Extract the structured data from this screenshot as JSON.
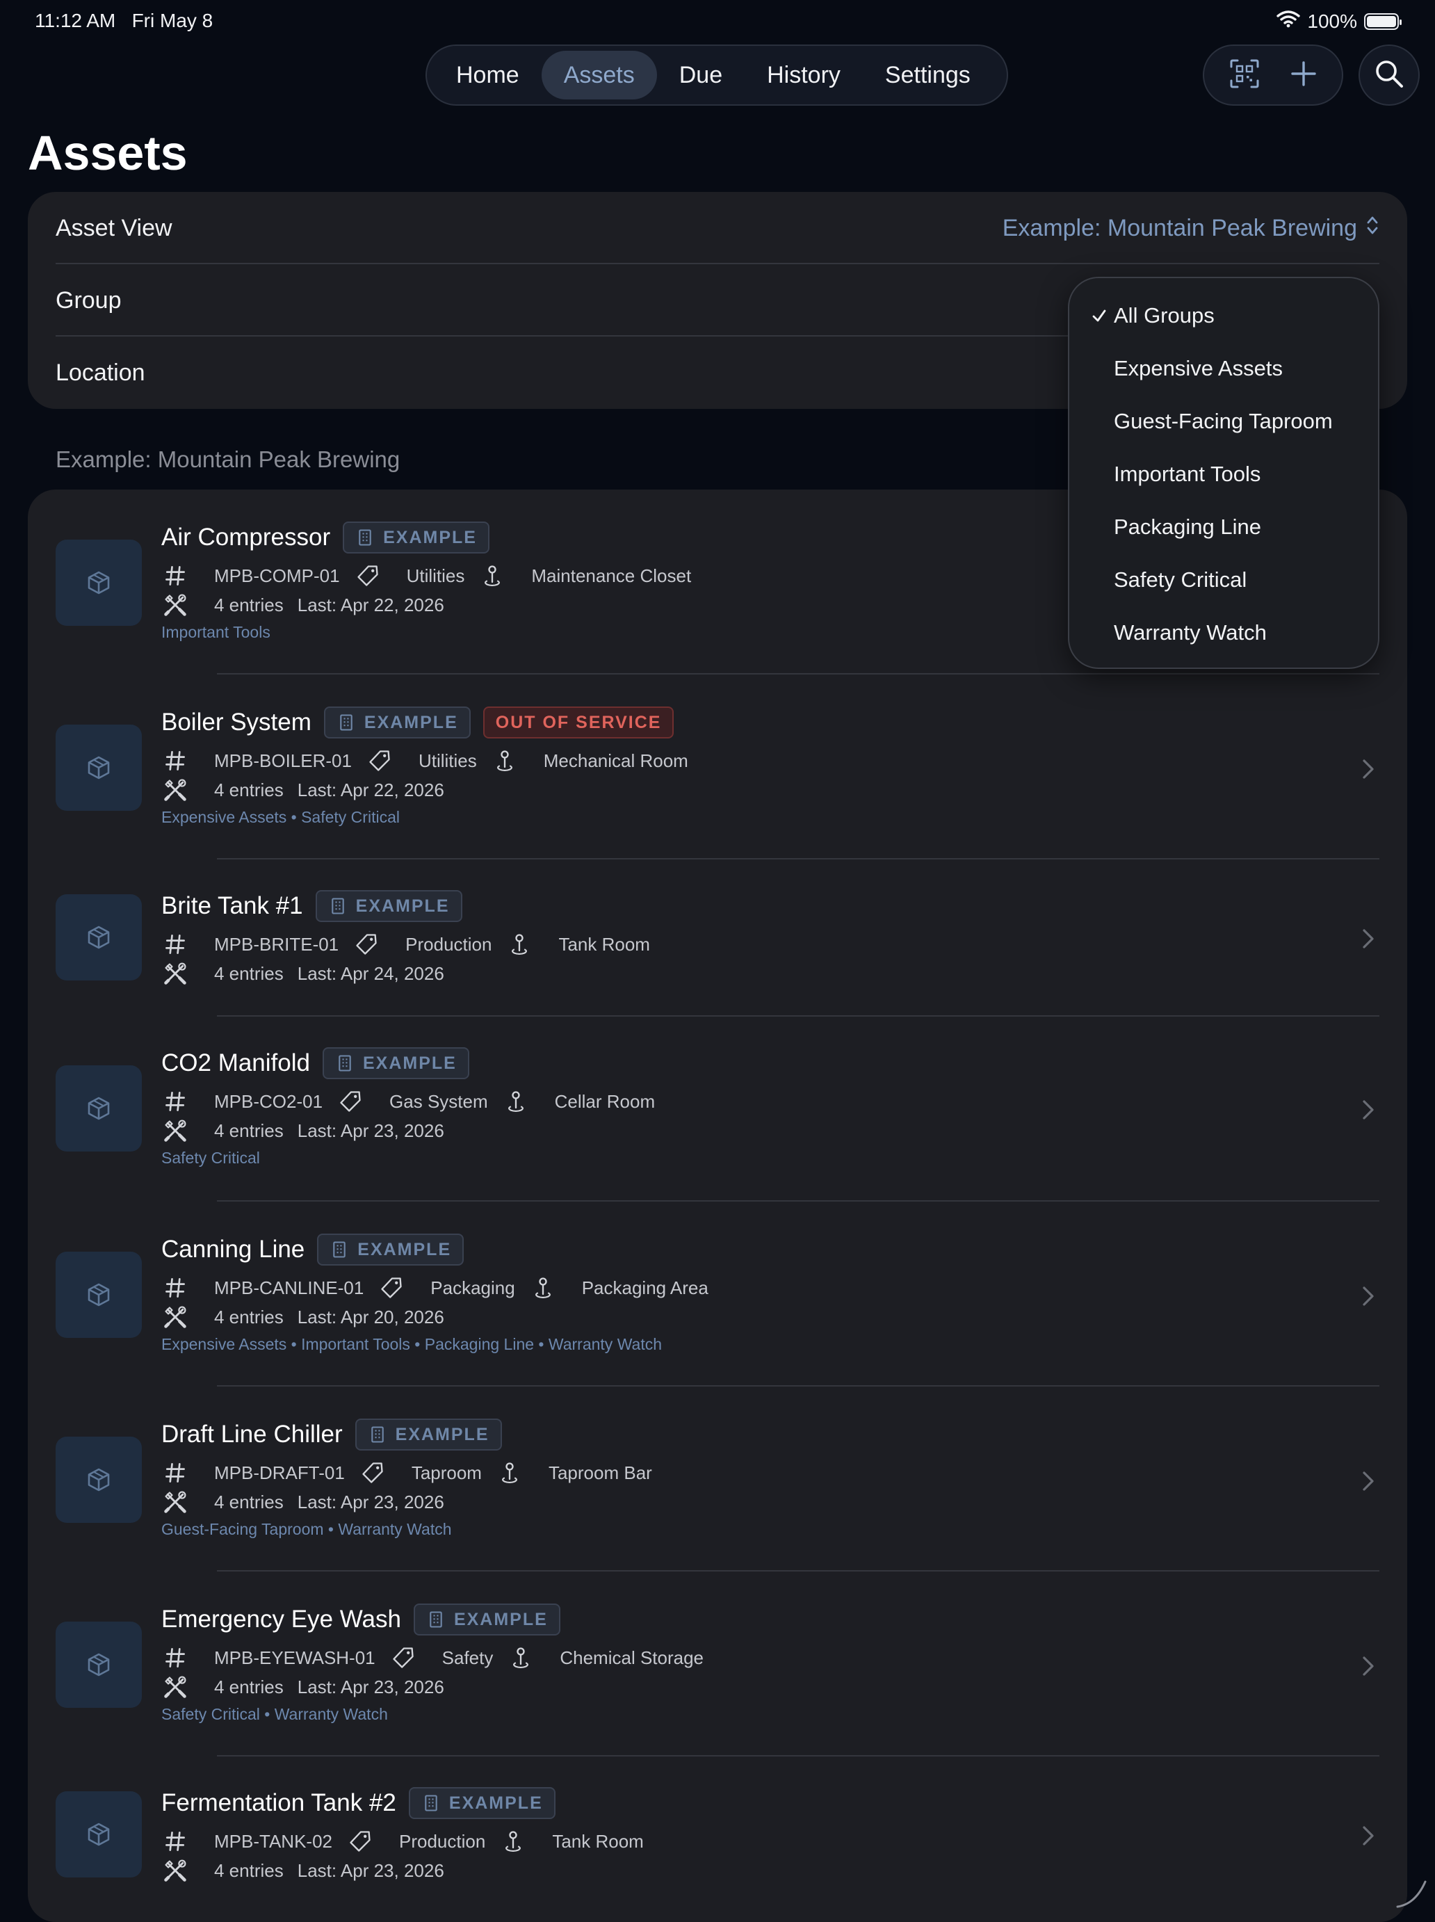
{
  "status_bar": {
    "time": "11:12 AM",
    "date": "Fri May 8",
    "battery": "100%"
  },
  "nav": {
    "tabs": [
      {
        "label": "Home"
      },
      {
        "label": "Assets",
        "active": true
      },
      {
        "label": "Due"
      },
      {
        "label": "History"
      },
      {
        "label": "Settings"
      }
    ],
    "icons": [
      "qr-scan-icon",
      "plus-icon",
      "search-icon"
    ]
  },
  "page_title": "Assets",
  "filters": {
    "asset_view_label": "Asset View",
    "asset_view_value": "Example: Mountain Peak Brewing",
    "group_label": "Group",
    "location_label": "Location"
  },
  "section_header": "Example: Mountain Peak Brewing",
  "example_badge": "EXAMPLE",
  "out_of_service_badge": "OUT OF SERVICE",
  "accent_color": "#8fa9cc",
  "group_dropdown": {
    "selected": "All Groups",
    "options": [
      "All Groups",
      "Expensive Assets",
      "Guest-Facing Taproom",
      "Important Tools",
      "Packaging Line",
      "Safety Critical",
      "Warranty Watch"
    ]
  },
  "assets": [
    {
      "name": "Air Compressor",
      "id": "MPB-COMP-01",
      "category": "Utilities",
      "location": "Maintenance Closet",
      "entries": "4 entries",
      "last": "Last: Apr 22, 2026",
      "groups": "Important Tools"
    },
    {
      "name": "Boiler System",
      "id": "MPB-BOILER-01",
      "category": "Utilities",
      "location": "Mechanical Room",
      "entries": "4 entries",
      "last": "Last: Apr 22, 2026",
      "groups": "Expensive Assets • Safety Critical",
      "out_of_service": true
    },
    {
      "name": "Brite Tank #1",
      "id": "MPB-BRITE-01",
      "category": "Production",
      "location": "Tank Room",
      "entries": "4 entries",
      "last": "Last: Apr 24, 2026",
      "groups": ""
    },
    {
      "name": "CO2 Manifold",
      "id": "MPB-CO2-01",
      "category": "Gas System",
      "location": "Cellar Room",
      "entries": "4 entries",
      "last": "Last: Apr 23, 2026",
      "groups": "Safety Critical"
    },
    {
      "name": "Canning Line",
      "id": "MPB-CANLINE-01",
      "category": "Packaging",
      "location": "Packaging Area",
      "entries": "4 entries",
      "last": "Last: Apr 20, 2026",
      "groups": "Expensive Assets • Important Tools • Packaging Line • Warranty Watch"
    },
    {
      "name": "Draft Line Chiller",
      "id": "MPB-DRAFT-01",
      "category": "Taproom",
      "location": "Taproom Bar",
      "entries": "4 entries",
      "last": "Last: Apr 23, 2026",
      "groups": "Guest-Facing Taproom • Warranty Watch"
    },
    {
      "name": "Emergency Eye Wash",
      "id": "MPB-EYEWASH-01",
      "category": "Safety",
      "location": "Chemical Storage",
      "entries": "4 entries",
      "last": "Last: Apr 23, 2026",
      "groups": "Safety Critical • Warranty Watch"
    },
    {
      "name": "Fermentation Tank #2",
      "id": "MPB-TANK-02",
      "category": "Production",
      "location": "Tank Room",
      "entries": "4 entries",
      "last": "Last: Apr 23, 2026",
      "groups": ""
    }
  ]
}
